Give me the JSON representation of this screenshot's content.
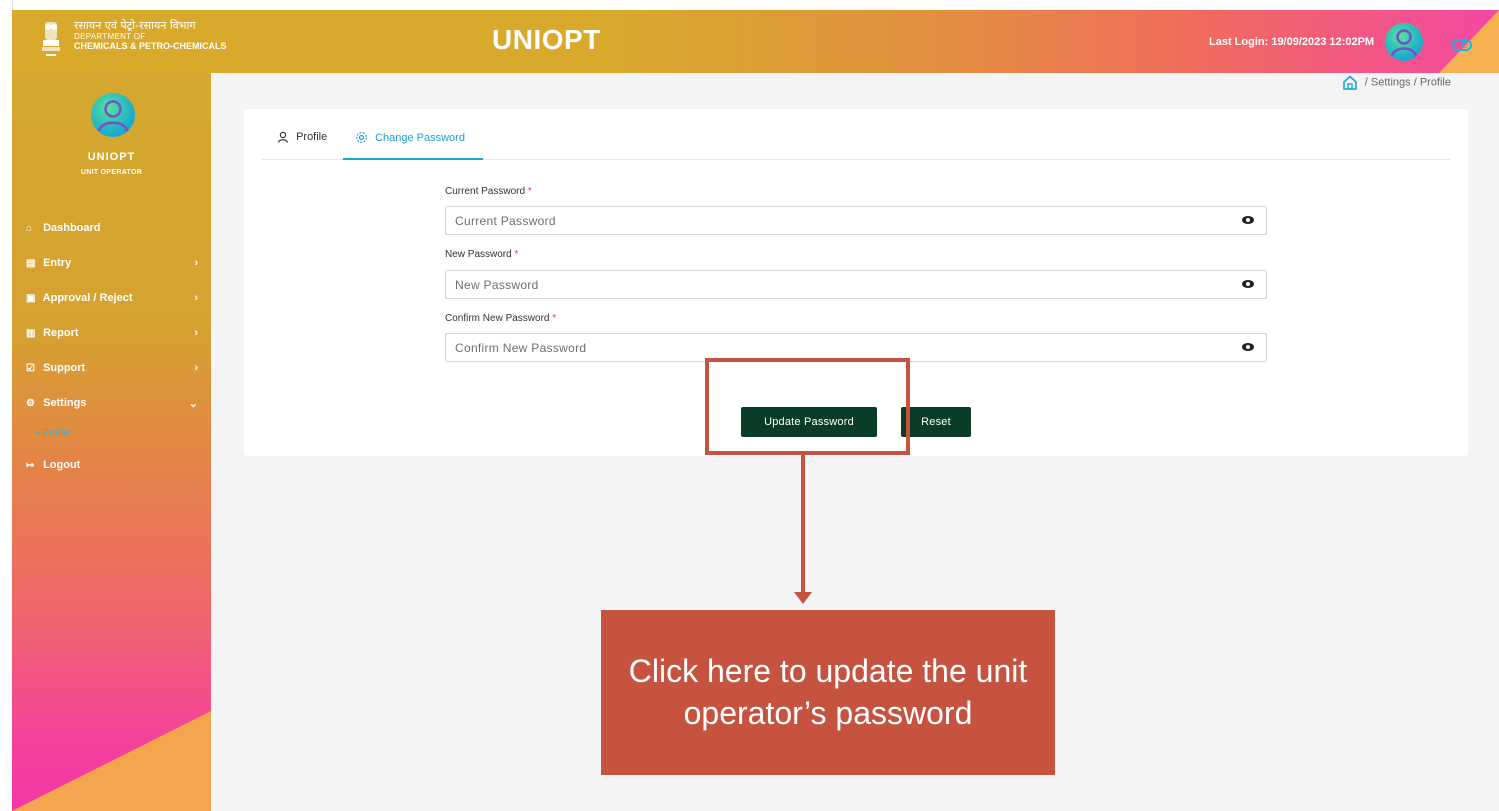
{
  "header": {
    "dept_hindi": "रसायन एवं पेट्रो-रसायन विभाग",
    "dept_line1": "DEPARTMENT OF",
    "dept_line2": "CHEMICALS & PETRO-CHEMICALS",
    "app_title": "UNIOPT",
    "last_login": "Last Login: 19/09/2023 12:02PM"
  },
  "sidebar": {
    "user_name": "UNIOPT",
    "user_role": "UNIT OPERATOR",
    "items": [
      {
        "label": "Dashboard",
        "icon": "home-icon",
        "chevron": ""
      },
      {
        "label": "Entry",
        "icon": "entry-icon",
        "chevron": "›"
      },
      {
        "label": "Approval / Reject",
        "icon": "approval-icon",
        "chevron": "›"
      },
      {
        "label": "Report",
        "icon": "report-icon",
        "chevron": "›"
      },
      {
        "label": "Support",
        "icon": "support-icon",
        "chevron": "›"
      },
      {
        "label": "Settings",
        "icon": "settings-icon",
        "chevron": "⌄"
      },
      {
        "label": "Logout",
        "icon": "logout-icon",
        "chevron": ""
      }
    ],
    "sub_item": "• Profile"
  },
  "breadcrumb": {
    "sep1": "/",
    "settings": "Settings",
    "sep2": "/",
    "profile": "Profile"
  },
  "tabs": {
    "profile": "Profile",
    "change_password": "Change Password"
  },
  "form": {
    "current_label": "Current Password",
    "current_placeholder": "Current Password",
    "new_label": "New Password",
    "new_placeholder": "New Password",
    "confirm_label": "Confirm New Password",
    "confirm_placeholder": "Confirm New Password",
    "required_mark": "*",
    "update_button": "Update Password",
    "reset_button": "Reset"
  },
  "annotation": {
    "callout_text": "Click here to update the unit operator’s password",
    "color": "#c55340"
  },
  "colors": {
    "accent": "#1aa3d8",
    "button": "#0a3d27",
    "required": "#e23b3b"
  }
}
